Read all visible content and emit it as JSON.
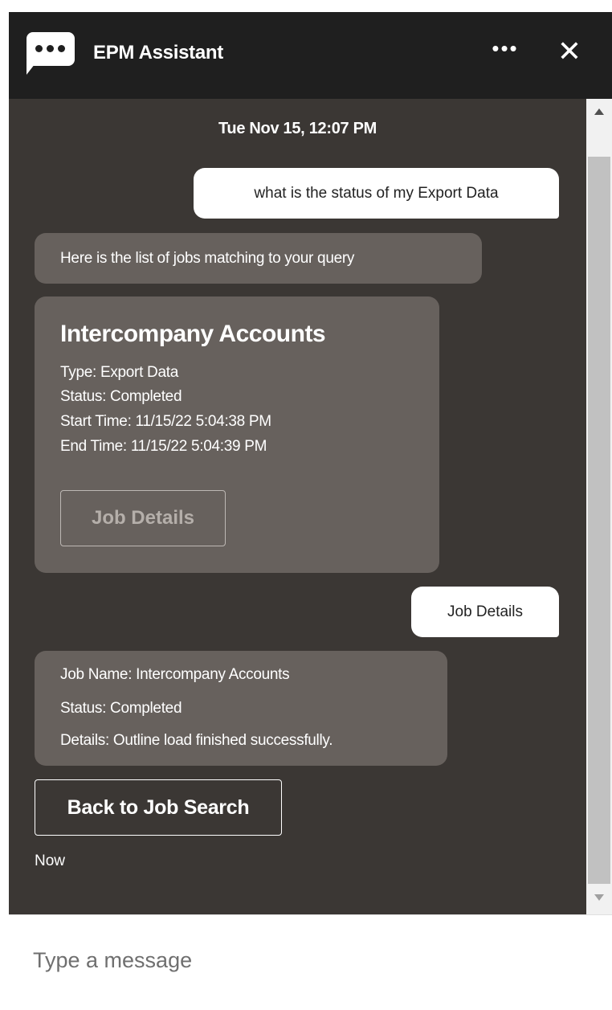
{
  "header": {
    "title": "EPM Assistant",
    "menu_icon": "ellipsis-icon",
    "close_icon": "close-icon",
    "logo_icon": "chat-bubble-icon"
  },
  "chat": {
    "timestamp": "Tue Nov 15, 12:07 PM",
    "messages": [
      {
        "from": "user",
        "text": "what is the status of my Export Data"
      },
      {
        "from": "bot",
        "text": "Here is the list of jobs matching to your query"
      }
    ],
    "job_card": {
      "title": "Intercompany Accounts",
      "lines": [
        "Type: Export Data",
        "Status: Completed",
        "Start Time: 11/15/22 5:04:38 PM",
        "End Time: 11/15/22 5:04:39 PM"
      ],
      "button_label": "Job Details"
    },
    "user_reply": "Job Details",
    "job_details": {
      "lines": [
        "Job Name: Intercompany Accounts",
        "Status: Completed",
        "Details: Outline load finished successfully."
      ]
    },
    "back_button_label": "Back to Job Search",
    "time_label": "Now"
  },
  "composer": {
    "placeholder": "Type a message"
  },
  "colors": {
    "header_bg": "#1f1f1f",
    "chat_bg": "#3b3734",
    "bot_bubble": "#67615d",
    "user_bubble": "#ffffff"
  }
}
